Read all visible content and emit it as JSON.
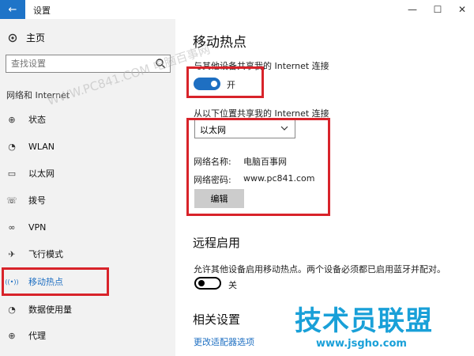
{
  "window": {
    "title": "设置",
    "back_glyph": "←",
    "minimize_glyph": "—",
    "maximize_glyph": "☐",
    "close_glyph": "✕"
  },
  "sidebar": {
    "home_label": "主页",
    "search_placeholder": "查找设置",
    "group_label": "网络和 Internet",
    "items": [
      {
        "label": "状态",
        "icon": "globe-icon",
        "glyph": "⊕"
      },
      {
        "label": "WLAN",
        "icon": "wifi-icon",
        "glyph": "◔"
      },
      {
        "label": "以太网",
        "icon": "ethernet-icon",
        "glyph": "▭"
      },
      {
        "label": "拨号",
        "icon": "phone-icon",
        "glyph": "☏"
      },
      {
        "label": "VPN",
        "icon": "vpn-icon",
        "glyph": "∞"
      },
      {
        "label": "飞行模式",
        "icon": "airplane-icon",
        "glyph": "✈"
      },
      {
        "label": "移动热点",
        "icon": "hotspot-icon",
        "glyph": "((•))",
        "active": true
      },
      {
        "label": "数据使用量",
        "icon": "data-usage-icon",
        "glyph": "◔"
      },
      {
        "label": "代理",
        "icon": "proxy-icon",
        "glyph": "⊕"
      }
    ],
    "accent_color": "#1e6fc2"
  },
  "main": {
    "title": "移动热点",
    "share_label": "与其他设备共享我的 Internet 连接",
    "share_toggle_state": "开",
    "share_from_label": "从以下位置共享我的 Internet 连接",
    "share_from_value": "以太网",
    "network_name_label": "网络名称:",
    "network_name_value": "电脑百事网",
    "network_password_label": "网络密码:",
    "network_password_value": "www.pc841.com",
    "edit_button": "编辑",
    "remote_title": "远程启用",
    "remote_desc": "允许其他设备启用移动热点。两个设备必须都已启用蓝牙并配对。",
    "remote_toggle_state": "关",
    "related_title": "相关设置",
    "related_link": "更改适配器选项"
  },
  "watermarks": {
    "diagonal": "WWW.PC841.COM 电脑百事网",
    "logo": "技术员联盟",
    "url": "www.jsgho.com"
  },
  "highlight_color": "#d8232a"
}
